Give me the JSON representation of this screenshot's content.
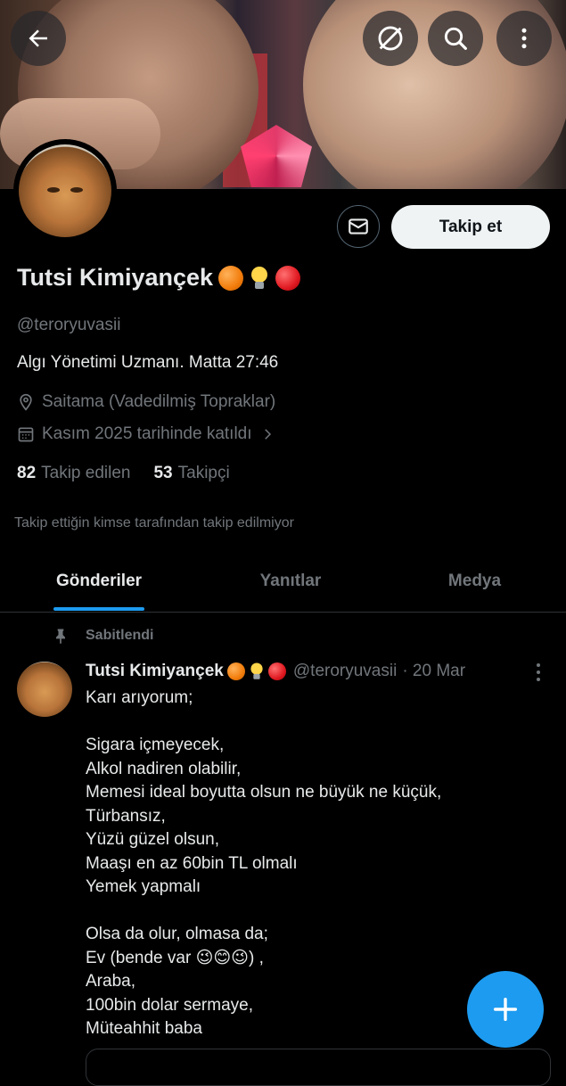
{
  "header": {
    "back_icon": "back-arrow-icon",
    "translate_icon": "translate-off-icon",
    "search_icon": "search-icon",
    "more_icon": "more-vertical-icon"
  },
  "profile": {
    "name": "Tutsi Kimiyançek",
    "name_emojis": [
      "orange-circle",
      "light-bulb",
      "red-circle"
    ],
    "handle": "@teroryuvasii",
    "bio": "Algı Yönetimi Uzmanı. Matta 27:46",
    "location": "Saitama (Vadedilmiş Topraklar)",
    "joined": "Kasım 2025 tarihinde katıldı",
    "following_count": "82",
    "following_label": "Takip edilen",
    "followers_count": "53",
    "followers_label": "Takipçi",
    "not_followed_note": "Takip ettiğin kimse tarafından takip edilmiyor",
    "follow_label": "Takip et"
  },
  "tabs": [
    {
      "label": "Gönderiler",
      "active": true
    },
    {
      "label": "Yanıtlar",
      "active": false
    },
    {
      "label": "Medya",
      "active": false
    }
  ],
  "pinned_post": {
    "pinned_label": "Sabitlendi",
    "author": "Tutsi Kimiyançek",
    "handle": "@teroryuvasii",
    "date": "· 20 Mar",
    "lines": [
      "Karı arıyorum;",
      "",
      "Sigara içmeyecek,",
      "Alkol nadiren olabilir,",
      "Memesi ideal boyutta olsun ne büyük ne küçük,",
      "Türbansız,",
      "Yüzü güzel olsun,",
      "Maaşı en az 60bin TL olmalı",
      "Yemek yapmalı",
      "",
      "Olsa da olur, olmasa da;",
      "Ev (bende var 😉😊😉) ,",
      "Araba,",
      "100bin dolar sermaye,",
      "Müteahhit baba"
    ]
  },
  "colors": {
    "accent": "#1d9bf0",
    "background": "#000000",
    "text": "#e7e9ea",
    "muted": "#71767b"
  }
}
